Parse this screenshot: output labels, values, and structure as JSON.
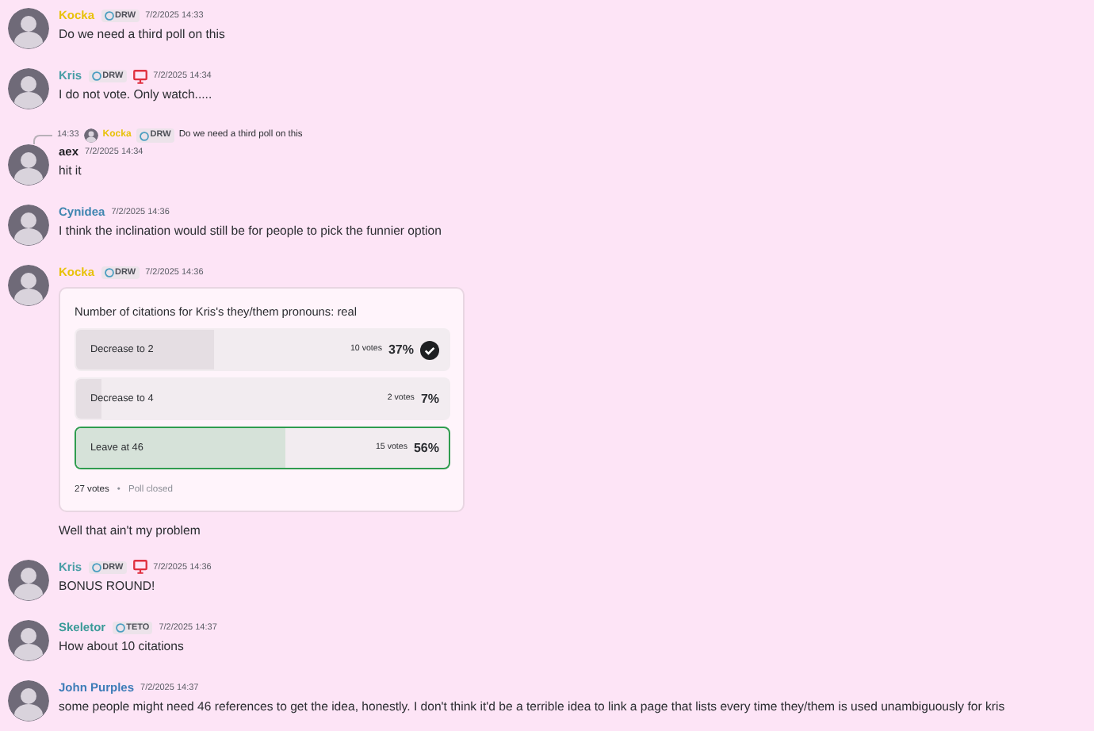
{
  "messages": [
    {
      "author": "Kocka",
      "color": "#e8c20a",
      "tag": "DRW",
      "timestamp": "7/2/2025 14:33",
      "text": "Do we need a third poll on this"
    },
    {
      "author": "Kris",
      "color": "#4a9ea6",
      "tag": "DRW",
      "desktop_badge": true,
      "timestamp": "7/2/2025 14:34",
      "text": "I do not vote. Only watch....."
    },
    {
      "author": "aex",
      "color": "#1e1e22",
      "timestamp": "7/2/2025 14:34",
      "reply": {
        "time": "14:33",
        "author": "Kocka",
        "color": "#e8c20a",
        "tag": "DRW",
        "text": "Do we need a third poll on this"
      },
      "text": "hit it"
    },
    {
      "author": "Cynidea",
      "color": "#3f86b0",
      "timestamp": "7/2/2025 14:36",
      "text": "I think the inclination would still be for people to pick the funnier option"
    },
    {
      "author": "Kocka",
      "color": "#e8c20a",
      "tag": "DRW",
      "timestamp": "7/2/2025 14:36",
      "poll": {
        "question": "Number of citations for Kris's they/them pronouns: real",
        "options": [
          {
            "label": "Decrease to 2",
            "votes": "10 votes",
            "percent": "37%",
            "level": 0.37,
            "voted": true,
            "winner": false
          },
          {
            "label": "Decrease to 4",
            "votes": "2 votes",
            "percent": "7%",
            "level": 0.07,
            "winner": false
          },
          {
            "label": "Leave at 46",
            "votes": "15 votes",
            "percent": "56%",
            "level": 0.56,
            "winner": true
          }
        ],
        "total": "27 votes",
        "separator": "•",
        "status": "Poll closed"
      },
      "text": "Well that ain't my problem"
    },
    {
      "author": "Kris",
      "color": "#4a9ea6",
      "tag": "DRW",
      "desktop_badge": true,
      "timestamp": "7/2/2025 14:36",
      "text": "BONUS ROUND!"
    },
    {
      "author": "Skeletor",
      "color": "#3a9a98",
      "tag": "TETO",
      "timestamp": "7/2/2025 14:37",
      "text": "How about 10 citations"
    },
    {
      "author": "John Purples",
      "color": "#3e7db8",
      "timestamp": "7/2/2025 14:37",
      "text": "some people might need 46 references to get the idea, honestly. I don't think it'd be a terrible idea to link a page that lists every time they/them is used unambiguously for kris"
    }
  ]
}
